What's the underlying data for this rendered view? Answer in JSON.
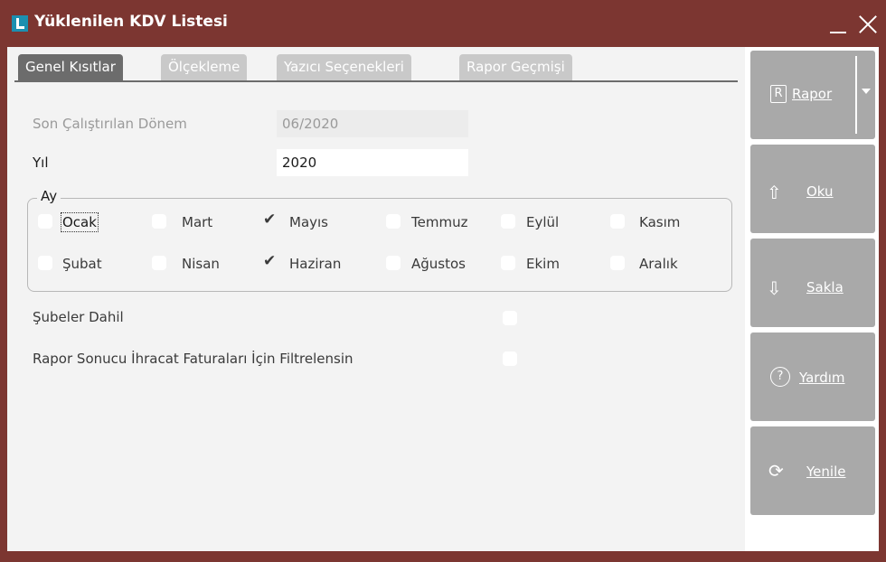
{
  "window": {
    "title": "Yüklenilen KDV Listesi",
    "logo_icon": "app-logo-icon",
    "accent_color": "#7c3631"
  },
  "tabs": [
    {
      "label": "Genel Kısıtlar",
      "active": true
    },
    {
      "label": "Ölçekleme",
      "active": false
    },
    {
      "label": "Yazıcı Seçenekleri",
      "active": false
    },
    {
      "label": "Rapor Geçmişi",
      "active": false
    }
  ],
  "form": {
    "last_period": {
      "label": "Son Çalıştırılan Dönem",
      "value": "06/2020",
      "readonly": true
    },
    "year": {
      "label": "Yıl",
      "value": "2020"
    },
    "month_group": {
      "title": "Ay",
      "months": [
        {
          "label": "Ocak",
          "checked": false,
          "focused": true
        },
        {
          "label": "Mart",
          "checked": false
        },
        {
          "label": "Mayıs",
          "checked": true
        },
        {
          "label": "Temmuz",
          "checked": false
        },
        {
          "label": "Eylül",
          "checked": false
        },
        {
          "label": "Kasım",
          "checked": false
        },
        {
          "label": "Şubat",
          "checked": false
        },
        {
          "label": "Nisan",
          "checked": false
        },
        {
          "label": "Haziran",
          "checked": true
        },
        {
          "label": "Ağustos",
          "checked": false
        },
        {
          "label": "Ekim",
          "checked": false
        },
        {
          "label": "Aralık",
          "checked": false
        }
      ]
    },
    "branches_included": {
      "label": "Şubeler Dahil",
      "checked": false
    },
    "export_filter": {
      "label": "Rapor Sonucu İhracat Faturaları İçin Filtrelensin",
      "checked": false
    }
  },
  "sidebar": {
    "report": {
      "label": "Rapor",
      "icon": "report-icon"
    },
    "read": {
      "label": "Oku",
      "icon": "open-icon"
    },
    "save": {
      "label": "Sakla",
      "icon": "save-icon"
    },
    "help": {
      "label": "Yardım",
      "icon": "help-icon"
    },
    "refresh": {
      "label": "Yenile",
      "icon": "refresh-icon"
    }
  }
}
